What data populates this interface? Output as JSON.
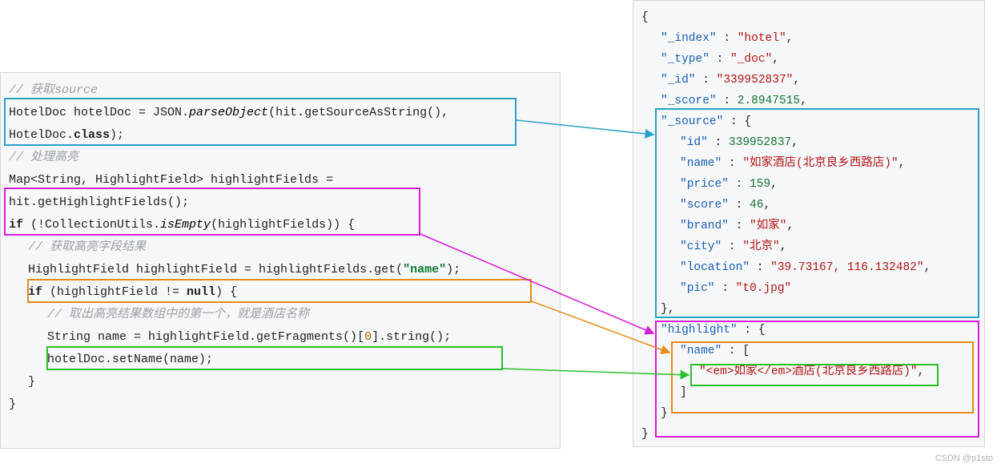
{
  "left": {
    "c1": "// 获取source",
    "l2a": "HotelDoc hotelDoc = JSON.",
    "l2b": "parseObject",
    "l2c": "(hit.getSourceAsString(),",
    "l3a": "HotelDoc.",
    "l3b": "class",
    "l3c": ");",
    "c2": "// 处理高亮",
    "l5": "Map<String, HighlightField> highlightFields =",
    "l6": "hit.getHighlightFields();",
    "l7a": "if",
    "l7b": " (!CollectionUtils.",
    "l7c": "isEmpty",
    "l7d": "(highlightFields)) {",
    "c3": "// 获取高亮字段结果",
    "l9a": "HighlightField highlightField = highlightFields.get(",
    "l9b": "\"name\"",
    "l9c": ");",
    "l10a": "if",
    "l10b": " (highlightField != ",
    "l10c": "null",
    "l10d": ") {",
    "c4": "// 取出高亮结果数组中的第一个，就是酒店名称",
    "l12a": "String name = highlightField.getFragments()[",
    "l12b": "0",
    "l12c": "].string();",
    "l13": "hotelDoc.setName(name);",
    "l14": "}",
    "l15": "}"
  },
  "right": {
    "open": "{",
    "index_k": "\"_index\"",
    "index_v": "\"hotel\"",
    "type_k": "\"_type\"",
    "type_v": "\"_doc\"",
    "id_k": "\"_id\"",
    "id_v": "\"339952837\"",
    "score_k": "\"_score\"",
    "score_v": "2.8947515",
    "source_k": "\"_source\"",
    "src_open": " : {",
    "s_id_k": "\"id\"",
    "s_id_v": "339952837",
    "s_name_k": "\"name\"",
    "s_name_v": "\"如家酒店(北京良乡西路店)\"",
    "s_price_k": "\"price\"",
    "s_price_v": "159",
    "s_score_k": "\"score\"",
    "s_score_v": "46",
    "s_brand_k": "\"brand\"",
    "s_brand_v": "\"如家\"",
    "s_city_k": "\"city\"",
    "s_city_v": "\"北京\"",
    "s_loc_k": "\"location\"",
    "s_loc_v": "\"39.73167, 116.132482\"",
    "s_pic_k": "\"pic\"",
    "s_pic_v": "\"t0.jpg\"",
    "src_close": "},",
    "hl_k": "\"highlight\"",
    "hl_open": " : {",
    "hl_name_k": "\"name\"",
    "hl_name_open": " : [",
    "hl_frag": "\"<em>如家</em>酒店(北京良乡西路店)\"",
    "hl_name_close": "]",
    "hl_close": "}",
    "close": "}",
    "colon": " : ",
    "comma": ","
  },
  "watermark": "CSDN @p1sto"
}
